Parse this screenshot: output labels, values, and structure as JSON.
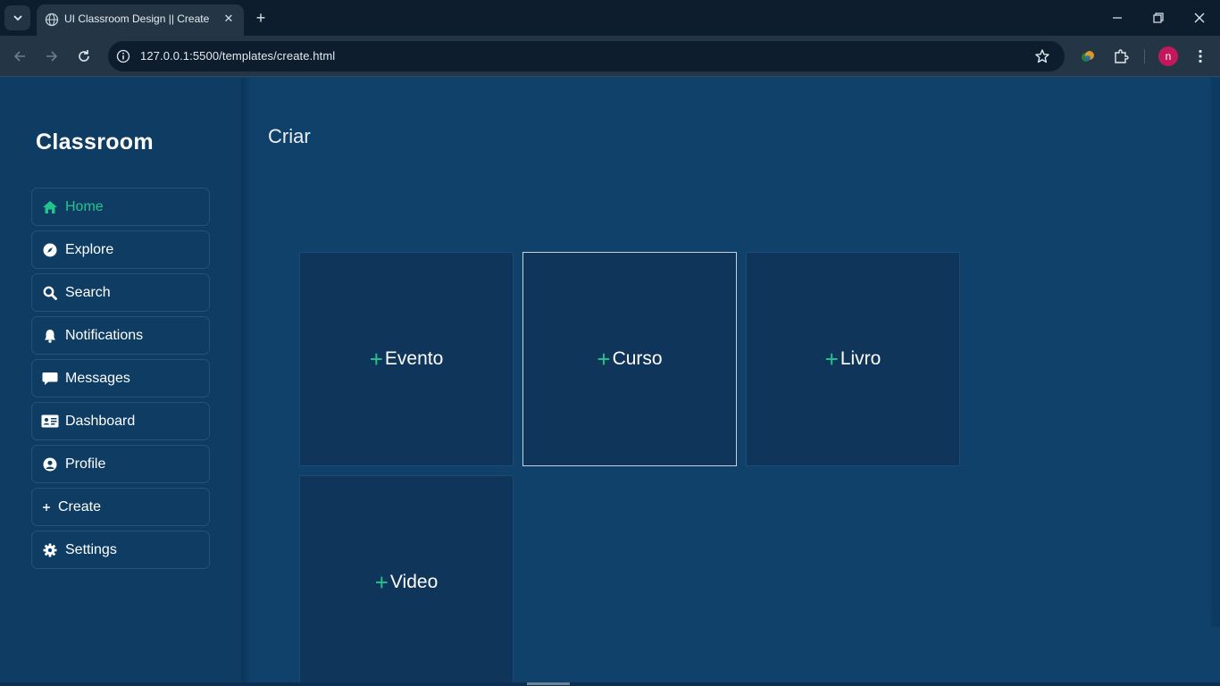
{
  "browser": {
    "tab_title": "UI Classroom Design || Create",
    "tab_close": "✕",
    "new_tab": "+",
    "url": "127.0.0.1:5500/templates/create.html",
    "profile_initial": "n"
  },
  "sidebar": {
    "brand": "Classroom",
    "items": [
      {
        "label": "Home",
        "icon": "home-icon",
        "active": true
      },
      {
        "label": "Explore",
        "icon": "compass-icon"
      },
      {
        "label": "Search",
        "icon": "search-icon"
      },
      {
        "label": "Notifications",
        "icon": "bell-icon"
      },
      {
        "label": "Messages",
        "icon": "message-icon"
      },
      {
        "label": "Dashboard",
        "icon": "id-card-icon"
      },
      {
        "label": "Profile",
        "icon": "user-circle-icon"
      },
      {
        "label": "Create",
        "icon": "plus-icon"
      },
      {
        "label": "Settings",
        "icon": "gear-icon"
      }
    ]
  },
  "main": {
    "title": "Criar",
    "cards": [
      {
        "plus": "+",
        "label": "Evento"
      },
      {
        "plus": "+",
        "label": "Curso"
      },
      {
        "plus": "+",
        "label": "Livro"
      },
      {
        "plus": "+",
        "label": "Video"
      }
    ]
  },
  "colors": {
    "page_bg": "#0f416b",
    "sidebar_bg": "#0e3c63",
    "card_bg": "#0f355a",
    "accent": "#23c48c",
    "avatar": "#c2185b"
  }
}
